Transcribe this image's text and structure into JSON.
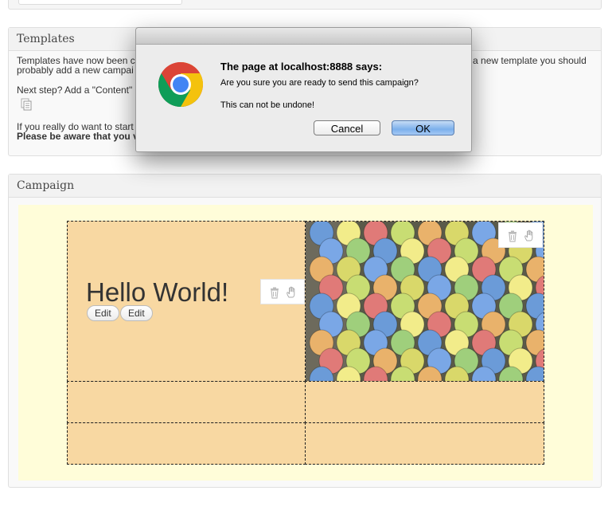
{
  "templates": {
    "header": "Templates",
    "line1": "Templates have now been c… e a new template you should",
    "line1_left": "Templates have now been c",
    "line1_right": "e a new template you should",
    "line1b": "probably add a new campai",
    "next_step": "Next step? Add a \"Content\"",
    "really_line": "If you really do want to start",
    "warning_line": "Please be aware that you v"
  },
  "campaign": {
    "header": "Campaign",
    "heading": "Hello World!",
    "edit_label_1": "Edit",
    "edit_label_2": "Edit"
  },
  "dialog": {
    "title": "The page at localhost:8888 says:",
    "message": "Are you sure you are ready to send this campaign?",
    "warning": "This can not be undone!",
    "cancel_label": "Cancel",
    "ok_label": "OK"
  },
  "colors": {
    "canvas_bg": "#fffdd9",
    "block_bg": "#f8d8a2",
    "ok_button": "#7cb0ec"
  },
  "icons": [
    "chrome-logo-icon",
    "trash-icon",
    "drag-hand-icon",
    "document-icon"
  ]
}
